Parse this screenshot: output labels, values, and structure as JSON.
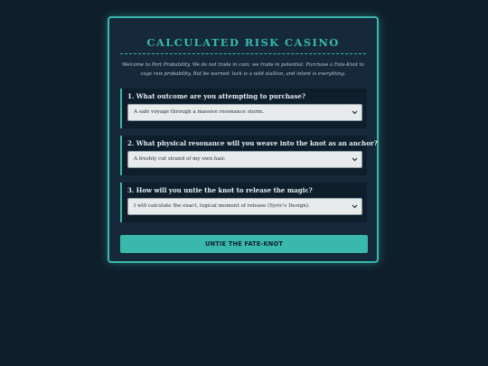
{
  "title": "CALCULATED RISK CASINO",
  "intro": "Welcome to Port Probability. We do not trade in coin; we trade in potential. Purchase a Fate-Knot to cage raw probability. But be warned: luck is a wild stallion, and intent is everything.",
  "questions": [
    {
      "label": "1. What outcome are you attempting to purchase?",
      "selected": "A safe voyage through a massive resonance storm."
    },
    {
      "label": "2. What physical resonance will you weave into the knot as an anchor?",
      "selected": "A freshly cut strand of my own hair."
    },
    {
      "label": "3. How will you untie the knot to release the magic?",
      "selected": "I will calculate the exact, logical moment of release (Syric's Design)."
    }
  ],
  "button_label": "UNTIE THE FATE-KNOT",
  "colors": {
    "background": "#0f1e2b",
    "panel": "#15293a",
    "accent": "#3ab8ac"
  },
  "icons": {
    "select_arrow": "chevron-down-icon"
  }
}
